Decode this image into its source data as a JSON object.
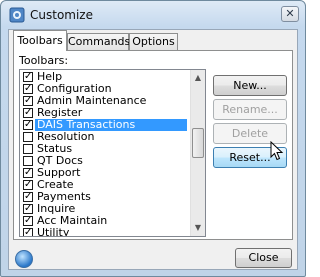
{
  "window": {
    "title": "Customize",
    "close_glyph": "✕"
  },
  "tabs": [
    {
      "label": "Toolbars",
      "active": true
    },
    {
      "label": "Commands",
      "active": false
    },
    {
      "label": "Options",
      "active": false
    }
  ],
  "toolbars_label": "Toolbars:",
  "toolbars": [
    {
      "label": "Help",
      "checked": true,
      "selected": false
    },
    {
      "label": "Configuration",
      "checked": true,
      "selected": false
    },
    {
      "label": "Admin Maintenance",
      "checked": true,
      "selected": false
    },
    {
      "label": "Register",
      "checked": true,
      "selected": false
    },
    {
      "label": "DAIS Transactions",
      "checked": true,
      "selected": true
    },
    {
      "label": "Resolution",
      "checked": false,
      "selected": false
    },
    {
      "label": "Status",
      "checked": false,
      "selected": false
    },
    {
      "label": "QT Docs",
      "checked": false,
      "selected": false
    },
    {
      "label": "Support",
      "checked": true,
      "selected": false
    },
    {
      "label": "Create",
      "checked": true,
      "selected": false
    },
    {
      "label": "Payments",
      "checked": true,
      "selected": false
    },
    {
      "label": "Inquire",
      "checked": true,
      "selected": false
    },
    {
      "label": "Acc Maintain",
      "checked": true,
      "selected": false
    },
    {
      "label": "Utility",
      "checked": true,
      "selected": false
    }
  ],
  "buttons": {
    "new": {
      "label": "New...",
      "enabled": true
    },
    "rename": {
      "label": "Rename...",
      "enabled": false
    },
    "delete": {
      "label": "Delete",
      "enabled": false
    },
    "reset": {
      "label": "Reset...",
      "enabled": true
    }
  },
  "footer": {
    "close_label": "Close"
  },
  "colors": {
    "selection": "#3399ff",
    "title_bar": "#c5d9ee"
  }
}
